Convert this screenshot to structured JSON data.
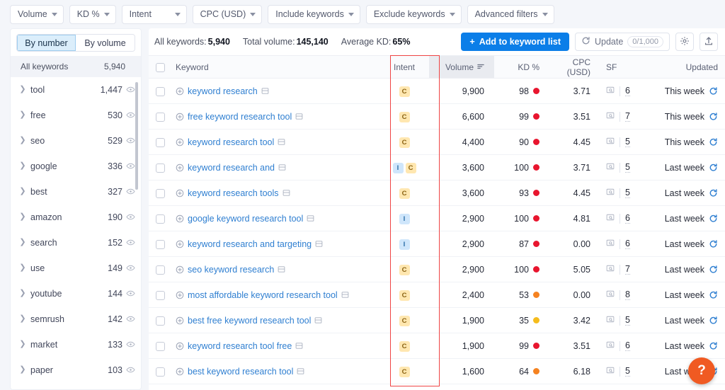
{
  "filters": [
    {
      "label": "Volume",
      "name": "filter-volume"
    },
    {
      "label": "KD %",
      "name": "filter-kd"
    },
    {
      "label": "Intent",
      "name": "filter-intent"
    },
    {
      "label": "CPC (USD)",
      "name": "filter-cpc"
    },
    {
      "label": "Include keywords",
      "name": "filter-include-keywords"
    },
    {
      "label": "Exclude keywords",
      "name": "filter-exclude-keywords"
    },
    {
      "label": "Advanced filters",
      "name": "filter-advanced"
    }
  ],
  "sidebar": {
    "tabs": [
      {
        "label": "By number",
        "active": true
      },
      {
        "label": "By volume",
        "active": false
      }
    ],
    "all_keywords_label": "All keywords",
    "all_keywords_count": "5,940",
    "items": [
      {
        "label": "tool",
        "count": "1,447"
      },
      {
        "label": "free",
        "count": "530"
      },
      {
        "label": "seo",
        "count": "529"
      },
      {
        "label": "google",
        "count": "336"
      },
      {
        "label": "best",
        "count": "327"
      },
      {
        "label": "amazon",
        "count": "190"
      },
      {
        "label": "search",
        "count": "152"
      },
      {
        "label": "use",
        "count": "149"
      },
      {
        "label": "youtube",
        "count": "144"
      },
      {
        "label": "semrush",
        "count": "142"
      },
      {
        "label": "market",
        "count": "133"
      },
      {
        "label": "paper",
        "count": "103"
      }
    ]
  },
  "summary": {
    "all_keywords_label": "All keywords:",
    "all_keywords_value": "5,940",
    "total_volume_label": "Total volume:",
    "total_volume_value": "145,140",
    "average_kd_label": "Average KD:",
    "average_kd_value": "65%",
    "add_button_label": "Add to keyword list",
    "update_label": "Update",
    "update_count": "0/1,000"
  },
  "table": {
    "columns": {
      "keyword": "Keyword",
      "intent": "Intent",
      "volume": "Volume",
      "kd": "KD %",
      "cpc": "CPC (USD)",
      "sf": "SF",
      "updated": "Updated"
    },
    "rows": [
      {
        "keyword": "keyword research",
        "intent": [
          "C"
        ],
        "volume": "9,900",
        "kd": "98",
        "kd_color": "#e8152e",
        "cpc": "3.71",
        "sf": "6",
        "updated": "This week"
      },
      {
        "keyword": "free keyword research tool",
        "intent": [
          "C"
        ],
        "volume": "6,600",
        "kd": "99",
        "kd_color": "#e8152e",
        "cpc": "3.51",
        "sf": "7",
        "updated": "This week"
      },
      {
        "keyword": "keyword research tool",
        "intent": [
          "C"
        ],
        "volume": "4,400",
        "kd": "90",
        "kd_color": "#e8152e",
        "cpc": "4.45",
        "sf": "5",
        "updated": "This week"
      },
      {
        "keyword": "keyword research and",
        "intent": [
          "I",
          "C"
        ],
        "volume": "3,600",
        "kd": "100",
        "kd_color": "#e8152e",
        "cpc": "3.71",
        "sf": "5",
        "updated": "Last week"
      },
      {
        "keyword": "keyword research tools",
        "intent": [
          "C"
        ],
        "volume": "3,600",
        "kd": "93",
        "kd_color": "#e8152e",
        "cpc": "4.45",
        "sf": "5",
        "updated": "Last week"
      },
      {
        "keyword": "google keyword research tool",
        "intent": [
          "I"
        ],
        "volume": "2,900",
        "kd": "100",
        "kd_color": "#e8152e",
        "cpc": "4.81",
        "sf": "6",
        "updated": "Last week"
      },
      {
        "keyword": "keyword research and targeting",
        "intent": [
          "I"
        ],
        "volume": "2,900",
        "kd": "87",
        "kd_color": "#e8152e",
        "cpc": "0.00",
        "sf": "6",
        "updated": "Last week"
      },
      {
        "keyword": "seo keyword research",
        "intent": [
          "C"
        ],
        "volume": "2,900",
        "kd": "100",
        "kd_color": "#e8152e",
        "cpc": "5.05",
        "sf": "7",
        "updated": "Last week"
      },
      {
        "keyword": "most affordable keyword research tool",
        "intent": [
          "C"
        ],
        "volume": "2,400",
        "kd": "53",
        "kd_color": "#f58220",
        "cpc": "0.00",
        "sf": "8",
        "updated": "Last week"
      },
      {
        "keyword": "best free keyword research tool",
        "intent": [
          "C"
        ],
        "volume": "1,900",
        "kd": "35",
        "kd_color": "#f5bc1c",
        "cpc": "3.42",
        "sf": "5",
        "updated": "Last week"
      },
      {
        "keyword": "keyword research tool free",
        "intent": [
          "C"
        ],
        "volume": "1,900",
        "kd": "99",
        "kd_color": "#e8152e",
        "cpc": "3.51",
        "sf": "6",
        "updated": "Last week"
      },
      {
        "keyword": "best keyword research tool",
        "intent": [
          "C"
        ],
        "volume": "1,600",
        "kd": "64",
        "kd_color": "#f58220",
        "cpc": "6.18",
        "sf": "5",
        "updated": "Last week"
      }
    ]
  },
  "help": {
    "label": "?"
  },
  "colors": {
    "accent_blue": "#0b7ee8",
    "link_blue": "#2f7fd1",
    "annotation_red": "#ef4444",
    "intent_commercial": "#ffe7b0",
    "intent_informational": "#cfe6fb",
    "help_orange": "#f05a22"
  }
}
